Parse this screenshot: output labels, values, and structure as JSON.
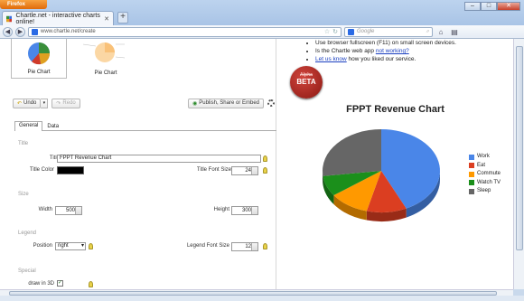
{
  "browser": {
    "app_button": "Firefox",
    "tab_title": "Chartle.net - interactive charts online!",
    "url": "www.chartle.net/create",
    "search_placeholder": "Google"
  },
  "left": {
    "thumbnails": [
      {
        "label": "Pie Chart"
      },
      {
        "label": "Pie Chart"
      }
    ],
    "toolbar": {
      "undo": "Undo",
      "redo": "Redo",
      "publish": "Publish, Share or Embed"
    },
    "tabs": [
      "General",
      "Data"
    ],
    "sections": {
      "title": "Title",
      "size": "Size",
      "legend": "Legend",
      "special": "Special"
    },
    "fields": {
      "title_label": "Title",
      "title_value": "FPPT Revenue Chart",
      "title_color_label": "Title Color",
      "title_font_size_label": "Title Font Size",
      "title_font_size_value": "24",
      "width_label": "Width",
      "width_value": "500",
      "height_label": "Height",
      "height_value": "300",
      "position_label": "Position",
      "position_value": "right",
      "legend_font_size_label": "Legend Font Size",
      "legend_font_size_value": "12",
      "draw3d_label": "draw in 3D",
      "draw3d_checked": "✓"
    }
  },
  "right": {
    "info": {
      "line1": "Use browser fullscreen (F11) on small screen devices.",
      "line2_prefix": "Is the Chartle web app ",
      "line2_link": "not working?",
      "line3_link": "Let us know",
      "line3_suffix": " how you liked our service."
    },
    "badge": {
      "strike": "Alpha",
      "text": "BETA"
    }
  },
  "chart_data": {
    "type": "pie",
    "title": "FPPT Revenue Chart",
    "categories": [
      "Work",
      "Eat",
      "Commute",
      "Watch TV",
      "Sleep"
    ],
    "values": [
      43,
      11,
      11,
      8,
      27
    ],
    "colors": [
      "#4a86e8",
      "#db3e21",
      "#ff9900",
      "#1b8f1b",
      "#666666"
    ],
    "legend_position": "right",
    "three_d": true
  }
}
